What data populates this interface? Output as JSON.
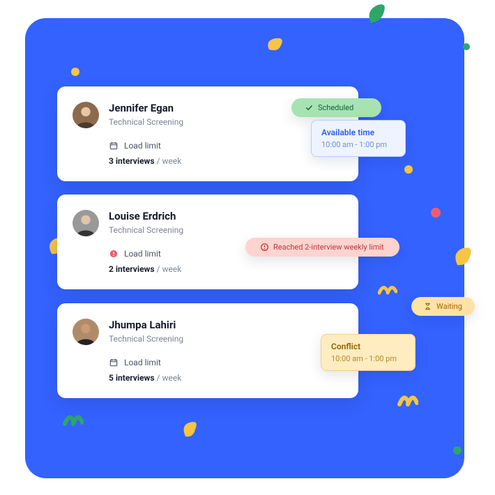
{
  "cards": [
    {
      "name": "Jennifer Egan",
      "role": "Technical Screening",
      "load_label": "Load limit",
      "count": "3 interviews",
      "per": "/ week",
      "load_icon": "calendar"
    },
    {
      "name": "Louise Erdrich",
      "role": "Technical Screening",
      "load_label": "Load limit",
      "count": "2 interviews",
      "per": "/ week",
      "load_icon": "warning"
    },
    {
      "name": "Jhumpa Lahiri",
      "role": "Technical Screening",
      "load_label": "Load limit",
      "count": "5 interviews",
      "per": "/ week",
      "load_icon": "calendar"
    }
  ],
  "badges": {
    "scheduled": "Scheduled",
    "limit": "Reached 2-interview weekly limit",
    "waiting": "Waiting"
  },
  "popovers": {
    "available": {
      "title": "Available time",
      "time": "10:00 am - 1:00 pm"
    },
    "conflict": {
      "title": "Conflict",
      "time": "10:00 am - 1:00 pm"
    }
  }
}
